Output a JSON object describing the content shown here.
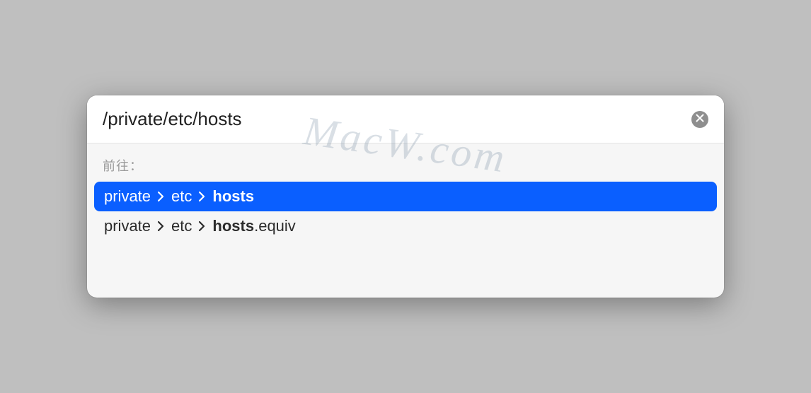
{
  "search": {
    "value": "/private/etc/hosts"
  },
  "section_label": "前往：",
  "results": [
    {
      "segments": [
        "private",
        "etc"
      ],
      "last_bold": "hosts",
      "last_rest": "",
      "selected": true
    },
    {
      "segments": [
        "private",
        "etc"
      ],
      "last_bold": "hosts",
      "last_rest": ".equiv",
      "selected": false
    }
  ],
  "watermark": "MacW.com"
}
